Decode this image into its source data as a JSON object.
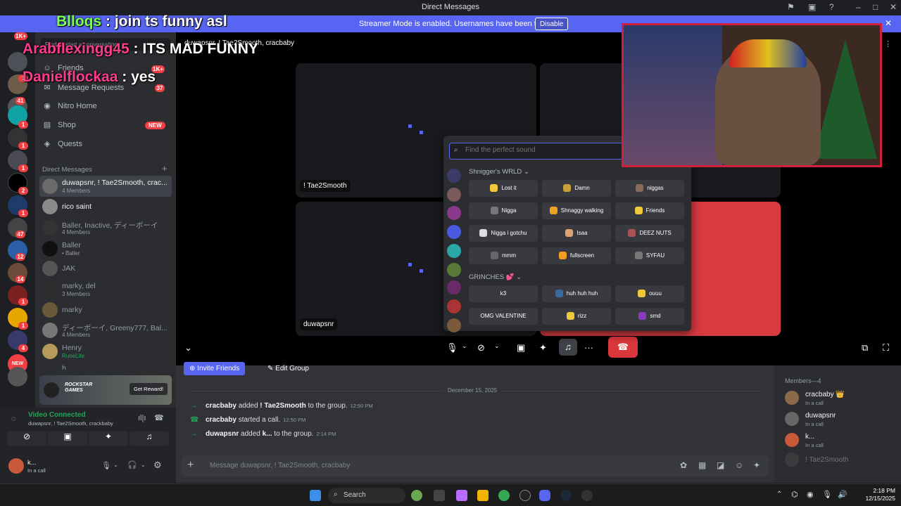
{
  "titlebar": {
    "title": "Direct Messages"
  },
  "banner": {
    "message": "Streamer Mode is enabled. Usernames have been truncated.",
    "button": "Disable"
  },
  "overlay_chat": [
    {
      "user": "Blloqs",
      "text": " : join ts funny asl",
      "color": "#7cff4f"
    },
    {
      "user": "Arabflexingg45",
      "text": " : ITS MAD FUNNY",
      "color": "#ff3b8d"
    },
    {
      "user": "Danielflockaa",
      "text": " : yes",
      "color": "#ff3b8d"
    }
  ],
  "rail": {
    "badges": [
      "1K+",
      "1",
      "41",
      "1",
      "1",
      "1",
      "2",
      "1",
      "47",
      "12",
      "14",
      "1",
      "1",
      "4"
    ],
    "new_label": "NEW"
  },
  "channels": {
    "search_placeholder": "Find or start a conversation",
    "nav": [
      {
        "label": "Friends",
        "badge": "1K+"
      },
      {
        "label": "Message Requests",
        "badge": "37"
      },
      {
        "label": "Nitro Home",
        "badge": ""
      },
      {
        "label": "Shop",
        "badge": "NEW"
      },
      {
        "label": "Quests",
        "badge": ""
      }
    ],
    "dm_header": "Direct Messages",
    "dms": [
      {
        "name": "duwapsnr, ! Tae2Smooth, crac...",
        "sub": "4 Members"
      },
      {
        "name": "rico saint",
        "sub": ""
      },
      {
        "name": "Baller, Inactive, ディーボーイ",
        "sub": "4 Members"
      },
      {
        "name": "Baller",
        "sub": "• Baller"
      },
      {
        "name": "JAK",
        "sub": ""
      },
      {
        "name": "marky, del",
        "sub": "3 Members"
      },
      {
        "name": "marky",
        "sub": ""
      },
      {
        "name": "ディーボーイ, Greeny777, Bal...",
        "sub": "4 Members"
      },
      {
        "name": "Henry",
        "sub": "RuneLite"
      },
      {
        "name": "h",
        "sub": ""
      }
    ]
  },
  "promo": {
    "brand": "ROCKSTAR GAMES",
    "button": "Get Reward!"
  },
  "voice": {
    "status": "Video Connected",
    "channel": "duwapsnr, ! Tae2Smooth, crackbaby"
  },
  "user": {
    "name": "k...",
    "status": "In a call"
  },
  "call": {
    "header": "duwapsnr, ! Tae2Smooth, cracbaby",
    "tiles": [
      "! Tae2Smooth",
      "duwapsnr"
    ]
  },
  "soundboard": {
    "search_placeholder": "Find the perfect sound",
    "groups": [
      {
        "name": "Shnigger's WRLD",
        "sounds": [
          "Lost it",
          "Damn",
          "niggas",
          "Nigga",
          "Shnaggy walking",
          "Friends",
          "Nigga i gotchu",
          "Isaa",
          "DEEZ NUTS",
          "mmm",
          "fullscreen",
          "SYFAU"
        ]
      },
      {
        "name": "GRINCHES 💕",
        "sounds": [
          "k3",
          "huh huh huh",
          "ouuu",
          "OMG VALENTINE",
          "rizz",
          "smd"
        ]
      }
    ]
  },
  "chat": {
    "buttons": {
      "invite": "Invite Friends",
      "edit": "Edit Group"
    },
    "date": "December 15, 2025",
    "messages": [
      {
        "user": "cracbaby",
        "action": " added ",
        "target": "! Tae2Smooth",
        "rest": " to the group.",
        "time": "12:50 PM"
      },
      {
        "user": "cracbaby",
        "action": " started a call.",
        "target": "",
        "rest": "",
        "time": "12:50 PM"
      },
      {
        "user": "duwapsnr",
        "action": " added ",
        "target": "k...",
        "rest": " to the group.",
        "time": "2:14 PM"
      }
    ],
    "input_placeholder": "Message duwapsnr, ! Tae2Smooth, cracbaby"
  },
  "members": {
    "header": "Members—4",
    "list": [
      {
        "name": "cracbaby 👑",
        "sub": "In a call"
      },
      {
        "name": "duwapsnr",
        "sub": "In a call"
      },
      {
        "name": "k...",
        "sub": "In a call"
      },
      {
        "name": "! Tae2Smooth",
        "sub": ""
      }
    ]
  },
  "taskbar": {
    "search": "Search",
    "time": "2:18 PM",
    "date": "12/15/2025"
  }
}
